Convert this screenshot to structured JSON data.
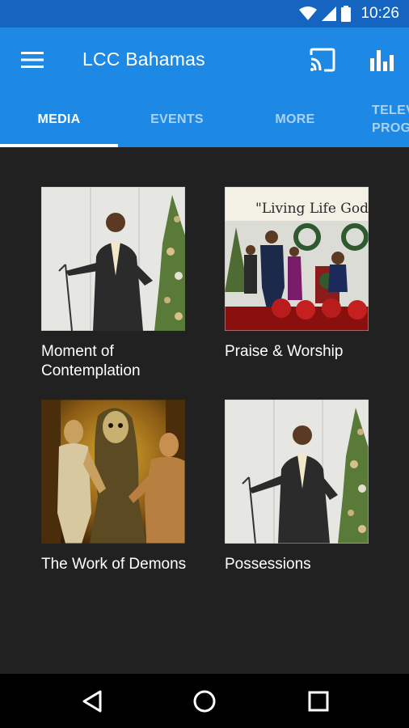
{
  "status": {
    "time": "10:26",
    "icons": [
      "wifi-icon",
      "signal-icon",
      "battery-icon"
    ]
  },
  "app_bar": {
    "title": "LCC Bahamas",
    "menu_icon": "hamburger-menu-icon",
    "cast_icon": "cast-icon",
    "stats_icon": "bar-chart-icon"
  },
  "tabs": [
    {
      "label": "MEDIA",
      "active": true
    },
    {
      "label": "EVENTS",
      "active": false
    },
    {
      "label": "MORE",
      "active": false
    },
    {
      "label": "TELEV\nPROG",
      "active": false
    }
  ],
  "media": [
    {
      "title": "Moment of Contemplation",
      "thumb_banner": ""
    },
    {
      "title": "Praise & Worship",
      "thumb_banner": "\"Living Life God's"
    },
    {
      "title": "The Work of Demons",
      "thumb_banner": ""
    },
    {
      "title": "Possessions",
      "thumb_banner": ""
    }
  ],
  "nav": {
    "back": "back-triangle-icon",
    "home": "home-circle-icon",
    "recents": "recents-square-icon"
  },
  "colors": {
    "status_bar": "#1565c0",
    "app_bar": "#1e88e5",
    "background": "#212121",
    "nav_bar": "#000000"
  }
}
